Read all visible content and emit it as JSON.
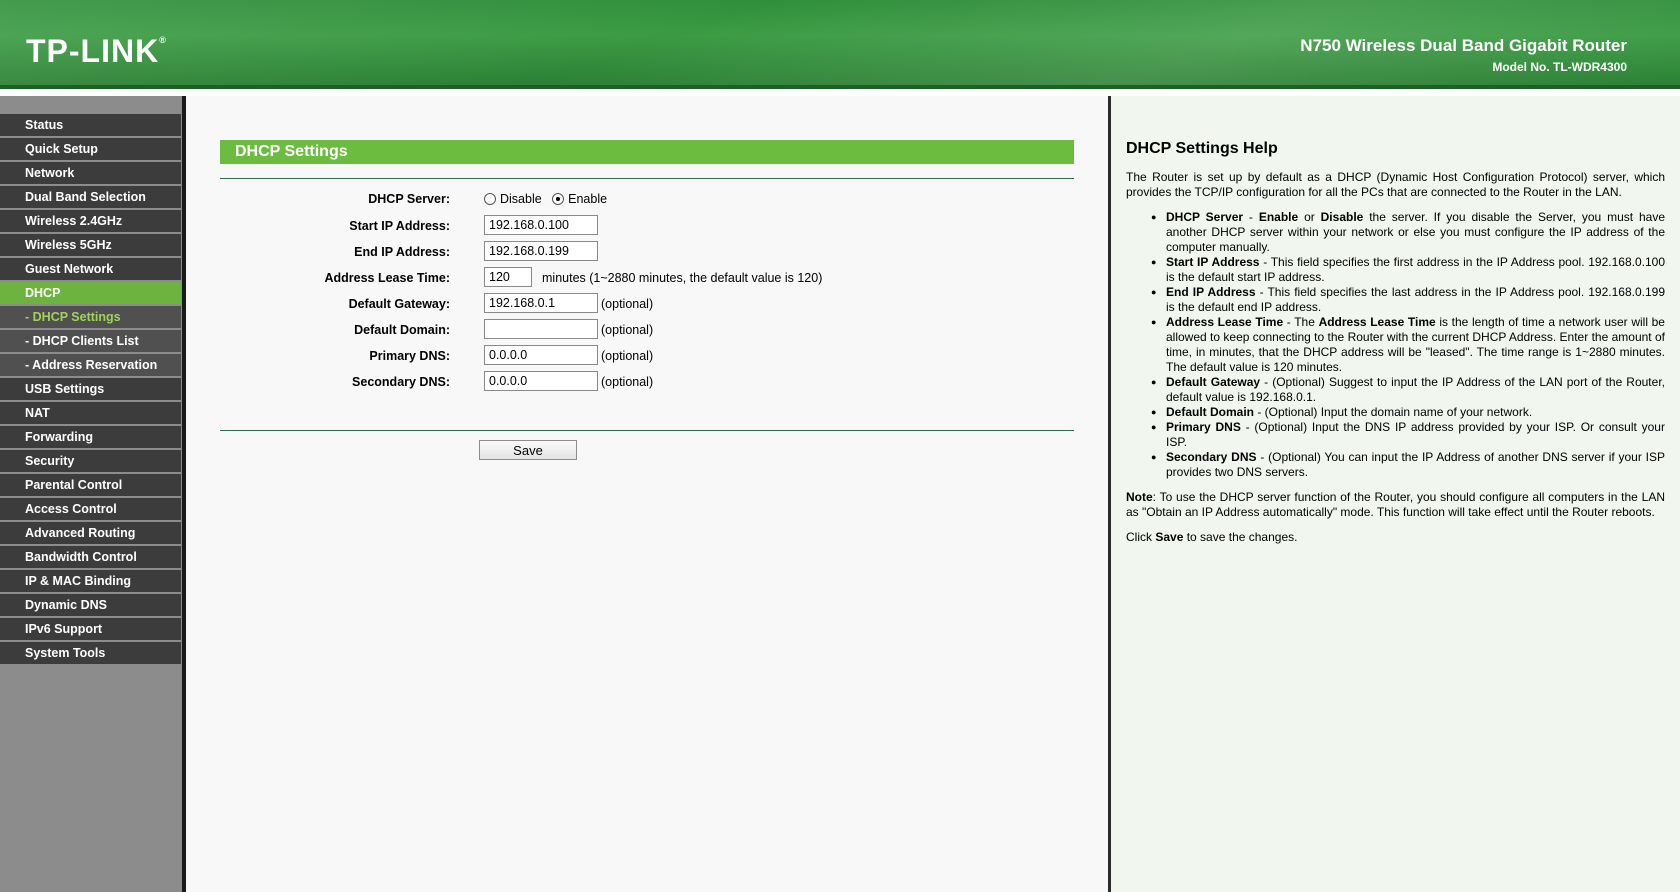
{
  "header": {
    "logo": "TP-LINK",
    "logo_mark": "®",
    "product_name": "N750 Wireless Dual Band Gigabit Router",
    "model": "Model No. TL-WDR4300"
  },
  "sidebar": {
    "items": [
      {
        "label": "Status",
        "sub": false,
        "active": false
      },
      {
        "label": "Quick Setup",
        "sub": false,
        "active": false
      },
      {
        "label": "Network",
        "sub": false,
        "active": false
      },
      {
        "label": "Dual Band Selection",
        "sub": false,
        "active": false
      },
      {
        "label": "Wireless 2.4GHz",
        "sub": false,
        "active": false
      },
      {
        "label": "Wireless 5GHz",
        "sub": false,
        "active": false
      },
      {
        "label": "Guest Network",
        "sub": false,
        "active": false
      },
      {
        "label": "DHCP",
        "sub": false,
        "active": true
      },
      {
        "label": "- DHCP Settings",
        "sub": true,
        "active": true
      },
      {
        "label": "- DHCP Clients List",
        "sub": true,
        "active": false
      },
      {
        "label": "- Address Reservation",
        "sub": true,
        "active": false
      },
      {
        "label": "USB Settings",
        "sub": false,
        "active": false
      },
      {
        "label": "NAT",
        "sub": false,
        "active": false
      },
      {
        "label": "Forwarding",
        "sub": false,
        "active": false
      },
      {
        "label": "Security",
        "sub": false,
        "active": false
      },
      {
        "label": "Parental Control",
        "sub": false,
        "active": false
      },
      {
        "label": "Access Control",
        "sub": false,
        "active": false
      },
      {
        "label": "Advanced Routing",
        "sub": false,
        "active": false
      },
      {
        "label": "Bandwidth Control",
        "sub": false,
        "active": false
      },
      {
        "label": "IP & MAC Binding",
        "sub": false,
        "active": false
      },
      {
        "label": "Dynamic DNS",
        "sub": false,
        "active": false
      },
      {
        "label": "IPv6 Support",
        "sub": false,
        "active": false
      },
      {
        "label": "System Tools",
        "sub": false,
        "active": false
      }
    ]
  },
  "main": {
    "section_title": "DHCP Settings",
    "dhcp_server": {
      "label": "DHCP Server:",
      "options": [
        "Disable",
        "Enable"
      ],
      "selected": "Enable"
    },
    "start_ip": {
      "label": "Start IP Address:",
      "value": "192.168.0.100"
    },
    "end_ip": {
      "label": "End IP Address:",
      "value": "192.168.0.199"
    },
    "lease_time": {
      "label": "Address Lease Time:",
      "value": "120",
      "note": "minutes (1~2880 minutes, the default value is 120)"
    },
    "gateway": {
      "label": "Default Gateway:",
      "value": "192.168.0.1",
      "note": "(optional)"
    },
    "domain": {
      "label": "Default Domain:",
      "value": "",
      "note": "(optional)"
    },
    "primary_dns": {
      "label": "Primary DNS:",
      "value": "0.0.0.0",
      "note": "(optional)"
    },
    "secondary_dns": {
      "label": "Secondary DNS:",
      "value": "0.0.0.0",
      "note": "(optional)"
    },
    "save_label": "Save"
  },
  "help": {
    "title": "DHCP Settings Help",
    "intro": "The Router is set up by default as a DHCP (Dynamic Host Configuration Protocol) server, which provides the TCP/IP configuration for all the PCs that are connected to the Router in the LAN.",
    "items": [
      {
        "term": "DHCP Server",
        "pre": " - ",
        "text_a": "Enable",
        "mid": " or ",
        "text_b": "Disable",
        "rest": " the server. If you disable the Server, you must have another DHCP server within your network or else you must configure the IP address of the computer manually."
      },
      {
        "term": "Start IP Address",
        "rest": " - This field specifies the first address in the IP Address pool. 192.168.0.100 is the default start IP address."
      },
      {
        "term": "End IP Address",
        "rest": " - This field specifies the last address in the IP Address pool. 192.168.0.199 is the default end IP address."
      },
      {
        "term": "Address Lease Time",
        "pre": " - The ",
        "text_a": "Address Lease Time",
        "rest": " is the length of time a network user will be allowed to keep connecting to the Router with the current DHCP Address. Enter the amount of time, in minutes, that the DHCP address will be \"leased\". The time range is 1~2880 minutes. The default value is 120 minutes."
      },
      {
        "term": "Default Gateway",
        "rest": " - (Optional) Suggest to input the IP Address of the LAN port of the Router, default value is 192.168.0.1."
      },
      {
        "term": "Default Domain",
        "rest": " - (Optional) Input the domain name of your network."
      },
      {
        "term": "Primary DNS",
        "rest": " - (Optional) Input the DNS IP address provided by your ISP. Or consult your ISP."
      },
      {
        "term": "Secondary DNS",
        "rest": " - (Optional) You can input the IP Address of another DNS server if your ISP provides two DNS servers."
      }
    ],
    "note_label": "Note",
    "note_text": ": To use the DHCP server function of the Router, you should configure all computers in the LAN as \"Obtain an IP Address automatically\" mode. This function will take effect until the Router reboots.",
    "click_pre": "Click ",
    "click_bold": "Save",
    "click_post": " to save the changes."
  }
}
